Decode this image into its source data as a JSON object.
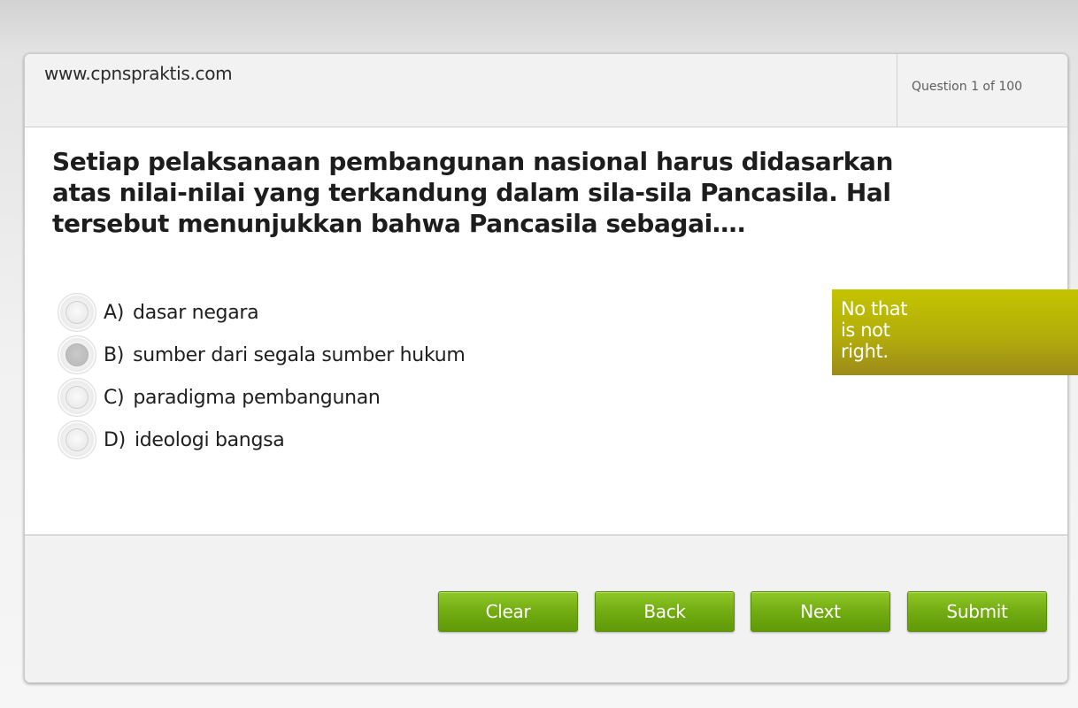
{
  "header": {
    "site_url": "www.cpnspraktis.com",
    "question_counter": "Question 1 of 100"
  },
  "question": {
    "text": "Setiap pelaksanaan pembangunan nasional harus didasarkan atas nilai-nilai yang terkandung dalam sila-sila Pancasila. Hal tersebut menunjukkan bahwa Pancasila sebagai…."
  },
  "options": [
    {
      "letter": "A)",
      "text": "dasar negara",
      "selected": false
    },
    {
      "letter": "B)",
      "text": "sumber dari segala sumber hukum",
      "selected": true
    },
    {
      "letter": "C)",
      "text": "paradigma pembangunan",
      "selected": false
    },
    {
      "letter": "D)",
      "text": "ideologi bangsa",
      "selected": false
    }
  ],
  "feedback": {
    "text": "No that is not right.",
    "color": "#b3ad0a"
  },
  "buttons": {
    "clear": "Clear",
    "back": "Back",
    "next": "Next",
    "submit": "Submit",
    "color": "#72ac12"
  }
}
